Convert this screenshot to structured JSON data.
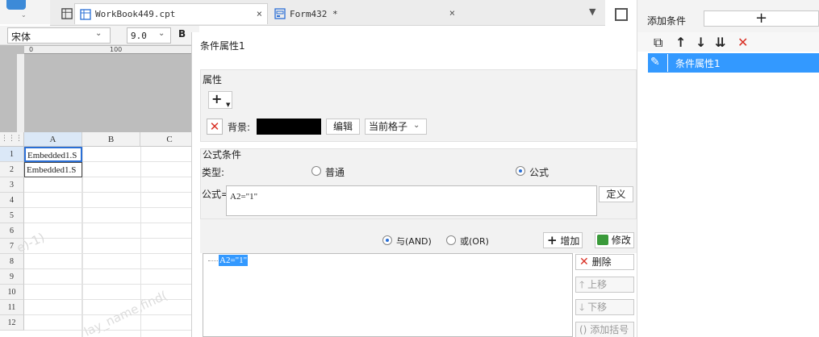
{
  "tabs": [
    {
      "label": "WorkBook449.cpt",
      "close": "×"
    },
    {
      "label": "Form432 *",
      "close": "×"
    }
  ],
  "format": {
    "font": "宋体",
    "size": "9.0",
    "bold": "B"
  },
  "ruler": {
    "zero": "0",
    "hundred": "100"
  },
  "sheet": {
    "columns": [
      "A",
      "B",
      "C"
    ],
    "rows": [
      "1",
      "2",
      "3",
      "4",
      "5",
      "6",
      "7",
      "8",
      "9",
      "10",
      "11",
      "12"
    ],
    "cells": {
      "A1": "Embedded1.S",
      "A2": "Embedded1.S"
    },
    "watermark1": "e)-1)",
    "watermark2": "lay_name,find("
  },
  "dialog": {
    "title": "条件属性1",
    "attr_group": "属性",
    "add_symbol": "+",
    "delete_symbol": "✕",
    "bg_label": "背景:",
    "bg_color": "#000000",
    "edit_label": "编辑",
    "scope_value": "当前格子",
    "formula_group": "公式条件",
    "type_label": "类型:",
    "type_normal": "普通",
    "type_formula": "公式",
    "formula_label": "公式=",
    "formula_value": "A2=\"1\"",
    "define_label": "定义",
    "and_label": "与(AND)",
    "or_label": "或(OR)",
    "add_label": "增加",
    "modify_label": "修改",
    "tree_item": "A2=\"1\"",
    "delete_label": "删除",
    "up_label": "上移",
    "down_label": "下移",
    "bracket_label": "添加括号"
  },
  "right_panel": {
    "add_condition_label": "添加条件",
    "add_symbol": "+",
    "selected_item": "条件属性1"
  },
  "colors": {
    "accent": "#3399ff",
    "danger": "#d93025",
    "selection": "#3399ff"
  }
}
